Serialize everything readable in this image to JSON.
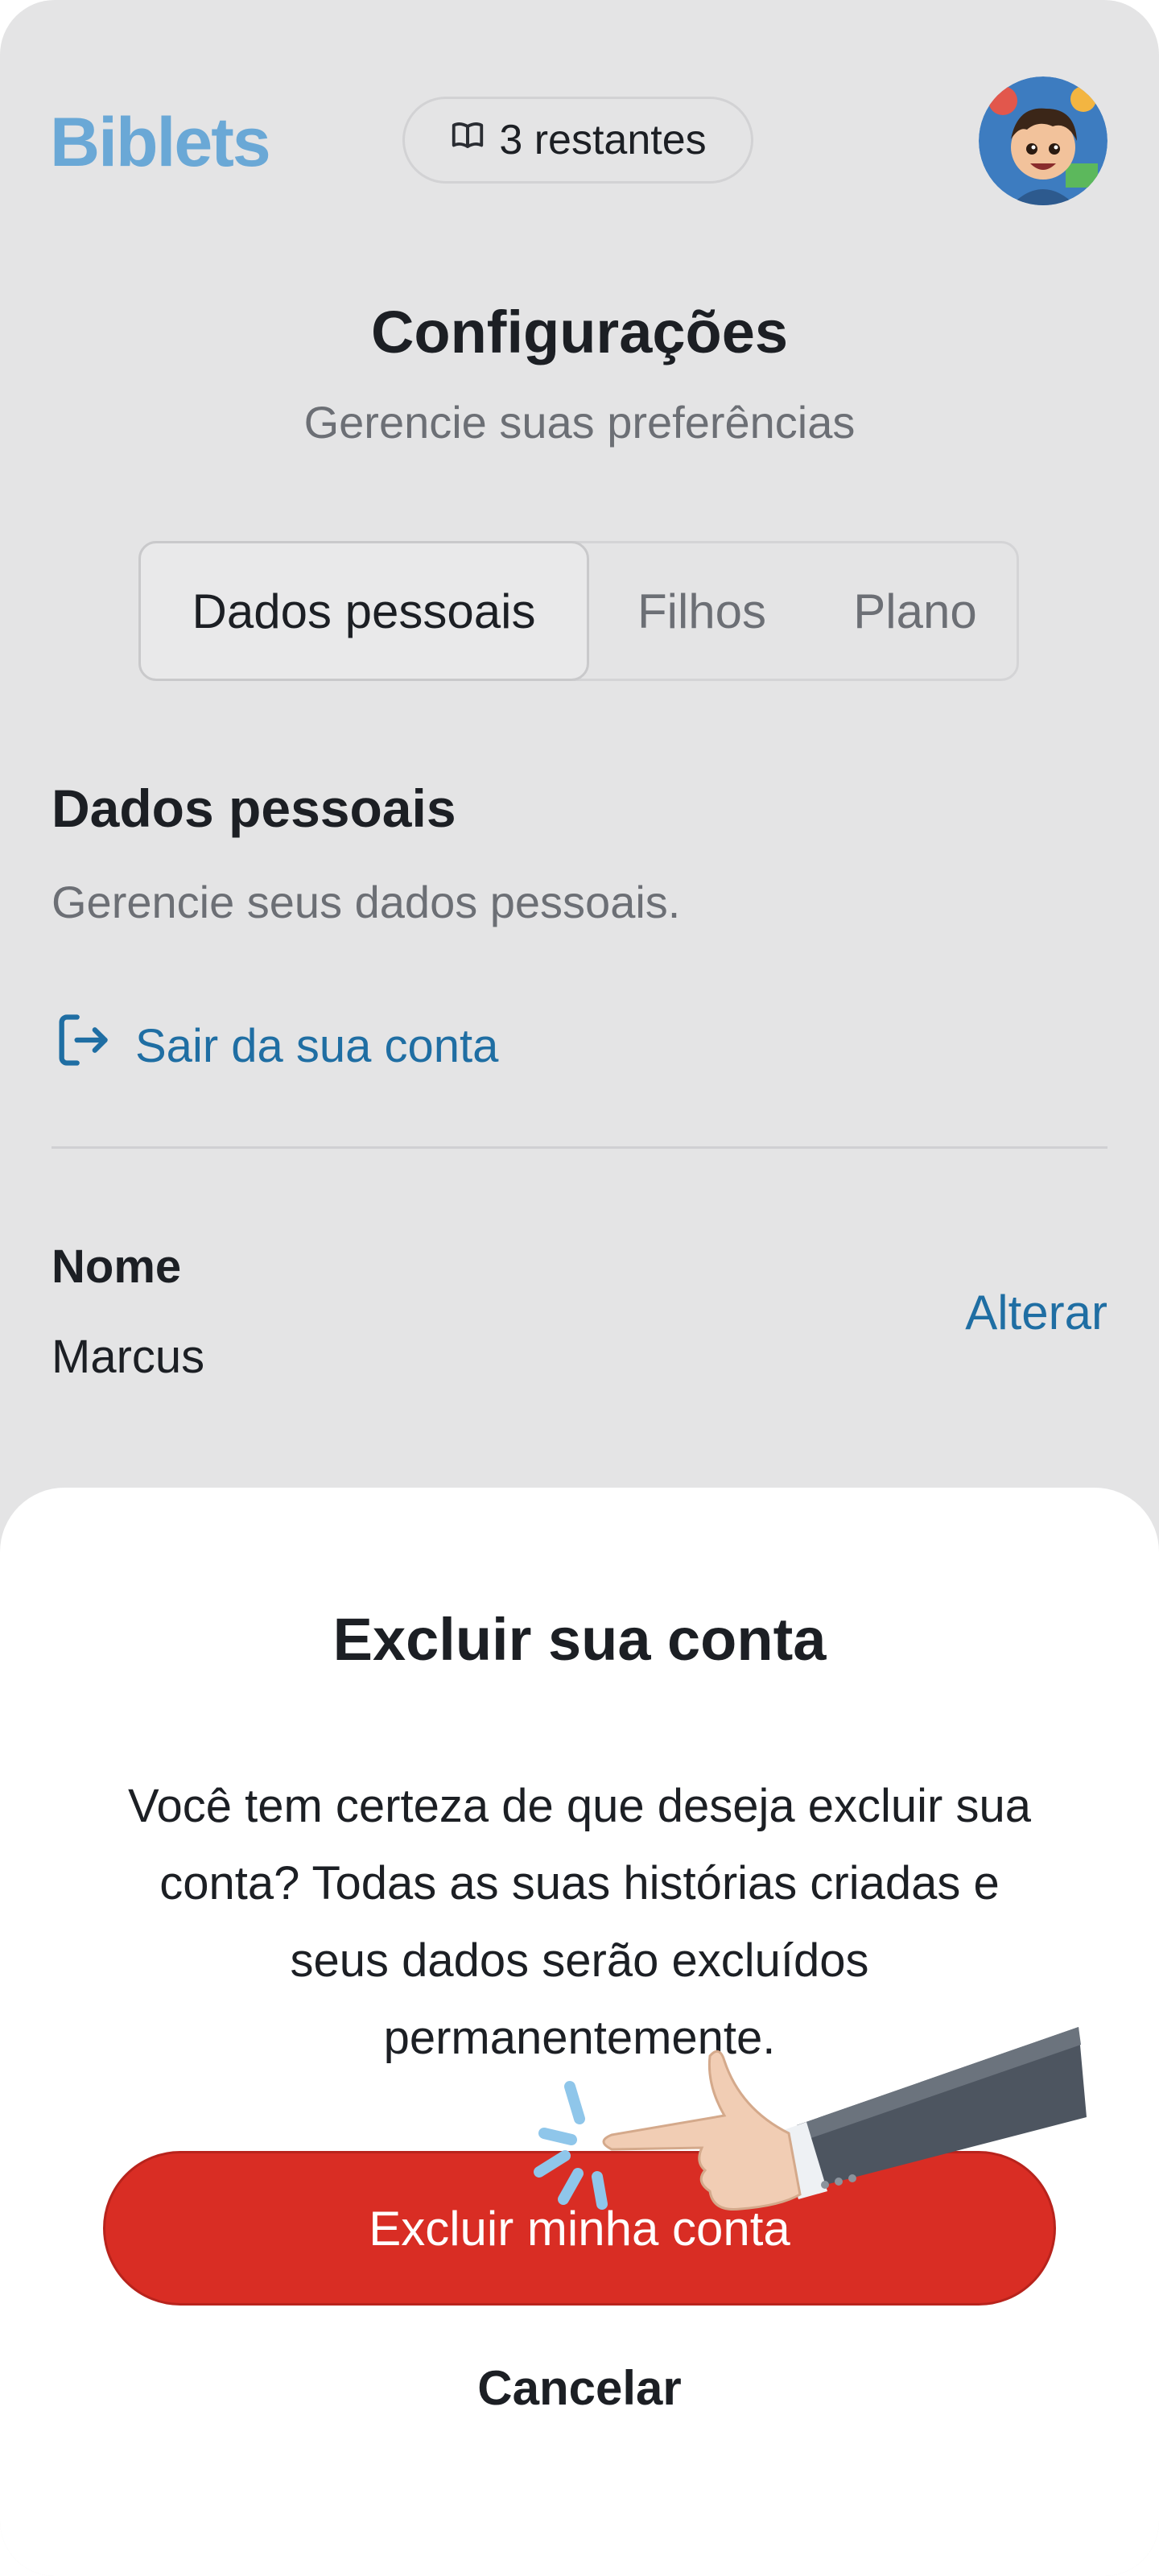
{
  "header": {
    "logo": "Biblets",
    "credits_label": "3 restantes"
  },
  "page": {
    "title": "Configurações",
    "subtitle": "Gerencie suas preferências"
  },
  "tabs": [
    {
      "label": "Dados pessoais",
      "active": true
    },
    {
      "label": "Filhos",
      "active": false
    },
    {
      "label": "Plano",
      "active": false
    }
  ],
  "section": {
    "title": "Dados pessoais",
    "description": "Gerencie seus dados pessoais.",
    "logout_label": "Sair da sua conta"
  },
  "fields": [
    {
      "label": "Nome",
      "value": "Marcus",
      "action": "Alterar"
    }
  ],
  "dialog": {
    "title": "Excluir sua conta",
    "body": "Você tem certeza de que deseja excluir sua conta? Todas as suas histórias criadas e seus dados serão excluídos permanentemente.",
    "confirm_label": "Excluir minha conta",
    "cancel_label": "Cancelar"
  },
  "colors": {
    "brand": "#6aa8d6",
    "link": "#1f6ea3",
    "danger": "#d92d24",
    "background": "#e4e4e5",
    "sheet": "#ffffff"
  },
  "icons": {
    "credits": "book-icon",
    "logout": "logout-icon",
    "avatar": "avatar",
    "pointer": "pointing-hand-icon"
  }
}
